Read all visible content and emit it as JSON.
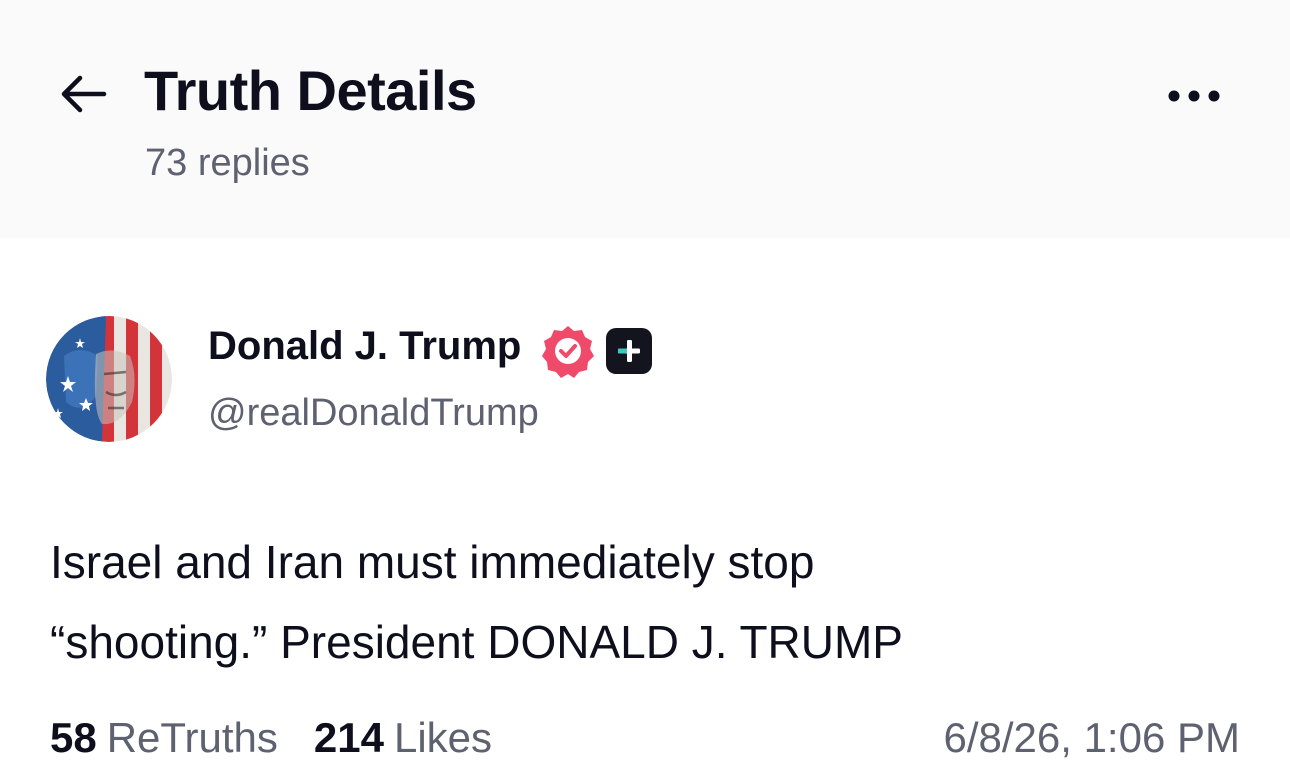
{
  "header": {
    "title": "Truth Details",
    "subtitle": "73 replies",
    "back_icon": "arrow-left-icon",
    "more_icon": "ellipsis-horizontal-icon"
  },
  "post": {
    "author": {
      "name": "Donald J. Trump",
      "handle": "@realDonaldTrump",
      "verified_icon": "verified-check-icon",
      "verified_color": "#f04a6a",
      "plus_icon": "plus-badge-icon"
    },
    "text_lines": [
      "Israel and Iran must immediately stop",
      "“shooting.” President DONALD J. TRUMP"
    ],
    "stats": {
      "retruths_count": "58",
      "retruths_label": "ReTruths",
      "likes_count": "214",
      "likes_label": "Likes"
    },
    "timestamp": "6/8/26, 1:06 PM"
  },
  "colors": {
    "header_bg": "#fafafb",
    "text_primary": "#0e0e1c",
    "text_secondary": "#5e6170",
    "verified_badge": "#f04a6a"
  }
}
